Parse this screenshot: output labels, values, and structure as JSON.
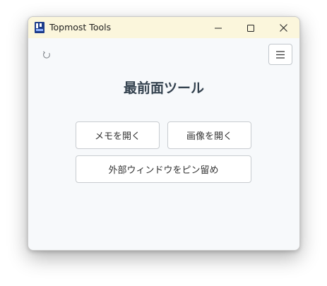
{
  "window": {
    "title": "Topmost Tools"
  },
  "main": {
    "heading": "最前面ツール",
    "buttons": {
      "open_memo": "メモを開く",
      "open_image": "画像を開く",
      "pin_external_window": "外部ウィンドウをピン留め"
    }
  },
  "icons": {
    "app": "app-logo-icon",
    "refresh": "refresh-icon",
    "menu": "hamburger-menu-icon",
    "minimize": "minimize-icon",
    "maximize": "maximize-icon",
    "close": "close-icon"
  },
  "colors": {
    "titlebar": "#fbf6dc",
    "background": "#f7f9fb",
    "heading": "#34424f"
  }
}
